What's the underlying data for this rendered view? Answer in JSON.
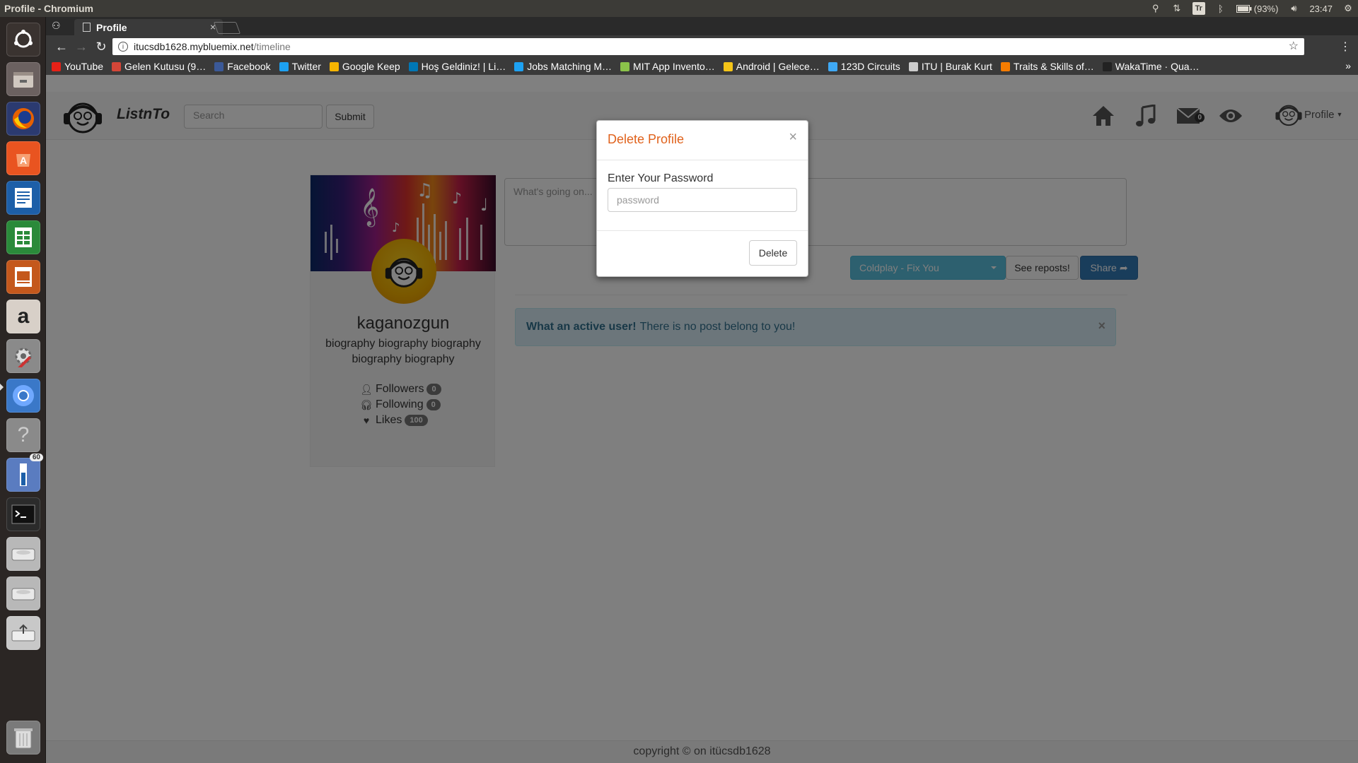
{
  "os": {
    "window_title": "Profile - Chromium",
    "battery": "(93%)",
    "clock": "23:47",
    "keyboard_layout": "Tr",
    "launcher_badge": "60",
    "icons": [
      "chromium-mini-icon",
      "network-updown-icon",
      "keyboard-layout-icon",
      "bluetooth-icon",
      "battery-icon",
      "volume-icon",
      "settings-gear-icon"
    ]
  },
  "browser": {
    "tab_title": "Profile",
    "url_host": "itucsdb1628.mybluemix.net",
    "url_path": "/timeline",
    "bookmarks": [
      {
        "label": "YouTube",
        "color": "#e62117"
      },
      {
        "label": "Gelen Kutusu (9…",
        "color": "#d44638"
      },
      {
        "label": "Facebook",
        "color": "#3b5998"
      },
      {
        "label": "Twitter",
        "color": "#1da1f2"
      },
      {
        "label": "Google Keep",
        "color": "#f7b500"
      },
      {
        "label": "Hoş Geldiniz! | Li…",
        "color": "#0077b5"
      },
      {
        "label": "Jobs Matching M…",
        "color": "#1da1f2"
      },
      {
        "label": "MIT App Invento…",
        "color": "#8bc34a"
      },
      {
        "label": "Android | Gelece…",
        "color": "#f5c518"
      },
      {
        "label": "123D Circuits",
        "color": "#3fa9f5"
      },
      {
        "label": "ITU | Burak Kurt",
        "color": "#cccccc"
      },
      {
        "label": "Traits & Skills of…",
        "color": "#f57c00"
      },
      {
        "label": "WakaTime · Qua…",
        "color": "#222222"
      }
    ],
    "bookmarks_more": "»"
  },
  "site": {
    "brand": "ListnTo",
    "search_placeholder": "Search",
    "search_button": "Submit",
    "messages_count": "0",
    "profile_menu": "Profile",
    "user": {
      "username": "kaganozgun",
      "bio": "biography biography biography biography biography",
      "followers_label": "Followers",
      "followers": "0",
      "following_label": "Following",
      "following": "0",
      "likes_label": "Likes",
      "likes": "100"
    },
    "composer": {
      "placeholder": "What's going on...",
      "song_selected": "Coldplay - Fix You",
      "reposts_button": "See reposts!",
      "share_button": "Share"
    },
    "alert": {
      "strong": "What an active user!",
      "text": "There is no post belong to you!"
    },
    "footer": "copyright © on itücsdb1628"
  },
  "modal": {
    "title": "Delete Profile",
    "close": "×",
    "label": "Enter Your Password",
    "input_placeholder": "password",
    "delete_button": "Delete"
  },
  "colors": {
    "modal_title": "#e0621c",
    "info_button": "#5bc0de",
    "primary_button": "#337ab7",
    "alert_bg": "#d9edf7"
  }
}
